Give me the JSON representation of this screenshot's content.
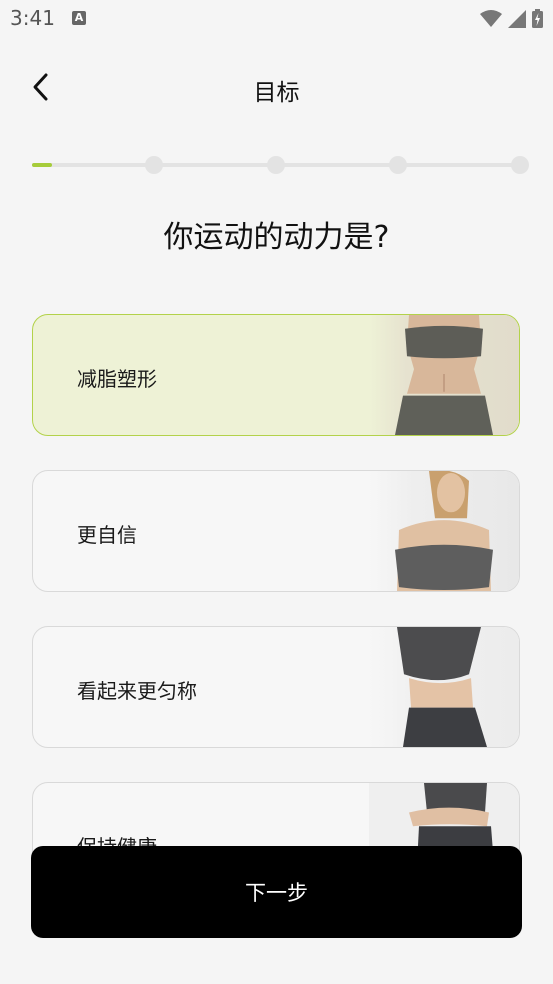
{
  "status_bar": {
    "time": "3:41",
    "notification_icon": "A",
    "icons": [
      "wifi-icon",
      "signal-icon",
      "battery-charging-icon"
    ]
  },
  "header": {
    "back_icon": "chevron-left-icon",
    "title": "目标"
  },
  "progress": {
    "total_steps": 5,
    "current_step": 1,
    "fill_fraction": 0.04,
    "accent_color": "#a6cc3a",
    "track_color": "#e3e3e3"
  },
  "question": "你运动的动力是?",
  "options": [
    {
      "label": "减脂塑形",
      "selected": true,
      "photo": "fitness-photo-waist"
    },
    {
      "label": "更自信",
      "selected": false,
      "photo": "fitness-photo-woman"
    },
    {
      "label": "看起来更匀称",
      "selected": false,
      "photo": "fitness-photo-pose"
    },
    {
      "label": "保持健康",
      "selected": false,
      "photo": "fitness-photo-back"
    }
  ],
  "next_button": {
    "label": "下一步"
  },
  "colors": {
    "selected_border": "#b3d24a",
    "selected_background": "#eef2d6",
    "button_background": "#000000"
  }
}
